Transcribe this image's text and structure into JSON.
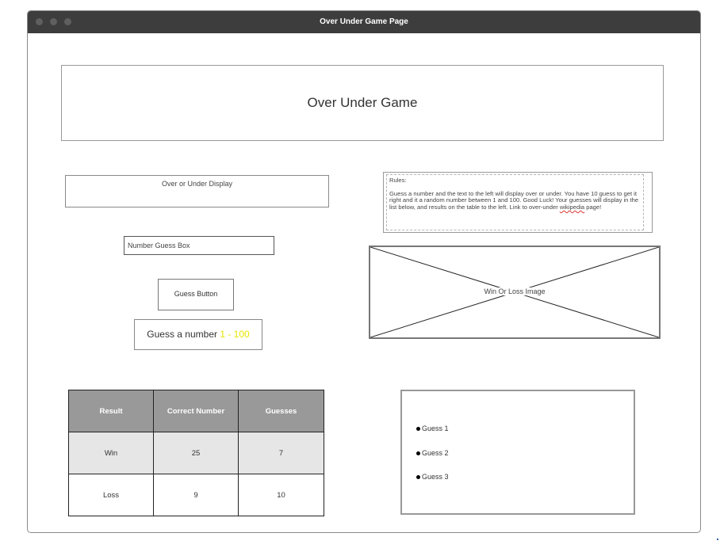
{
  "window": {
    "title": "Over Under Game Page"
  },
  "header": {
    "title": "Over Under Game"
  },
  "display": {
    "label": "Over or Under Display"
  },
  "guess_input": {
    "placeholder": "Number Guess Box"
  },
  "guess_button": {
    "label": "Guess Button"
  },
  "guess_prompt": {
    "label": "Guess a number",
    "range": "1 - 100",
    "range_color": "#e6e600"
  },
  "rules": {
    "title": "Rules:",
    "text_before_link": "Guess a number and the text to the left will display over or under. You have 10 guess to get it right and it a random number between 1 and 100. Good Luck!  Your guesses will display in the list below, and results on the table to the left. Link to over-under ",
    "link": "wikipedia",
    "text_after_link": " page!"
  },
  "image_placeholder": {
    "label": "Win Or Loss Image"
  },
  "results_table": {
    "headers": [
      "Result",
      "Correct Number",
      "Guesses"
    ],
    "rows": [
      [
        "Win",
        "25",
        "7"
      ],
      [
        "Loss",
        "9",
        "10"
      ]
    ],
    "header_color": "#999999"
  },
  "guess_list": {
    "items": [
      "Guess 1",
      "Guess 2",
      "Guess 3"
    ]
  },
  "colors": {
    "titlebar": "#3d3d3d"
  }
}
